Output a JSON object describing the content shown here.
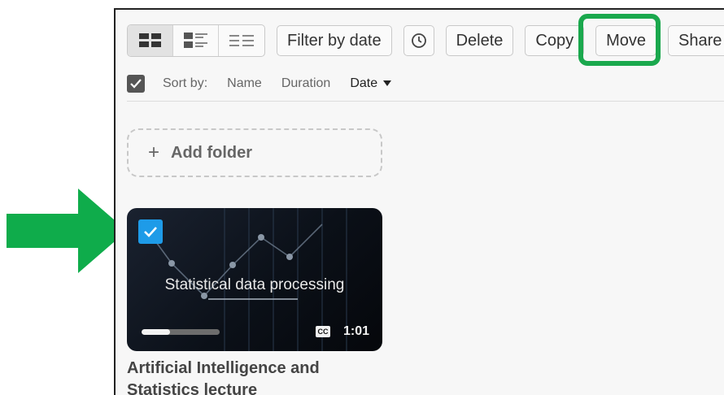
{
  "toolbar": {
    "view_modes": [
      "grid-view-icon",
      "list-thumb-view-icon",
      "list-view-icon"
    ],
    "filter_label": "Filter by date",
    "delete_label": "Delete",
    "copy_label": "Copy",
    "move_label": "Move",
    "share_label": "Share"
  },
  "sortbar": {
    "sort_label": "Sort by:",
    "options": [
      "Name",
      "Duration",
      "Date"
    ],
    "active": "Date"
  },
  "add_folder": {
    "label": "Add folder",
    "plus": "+"
  },
  "video": {
    "thumbnail_title": "Statistical data processing",
    "cc_label": "CC",
    "duration": "1:01",
    "progress_fraction": 0.36,
    "caption": "Artificial Intelligence and Statistics lecture"
  },
  "colors": {
    "highlight": "#1aa84d",
    "arrow": "#0fac4b",
    "checkbox_selected": "#1e9be8"
  }
}
